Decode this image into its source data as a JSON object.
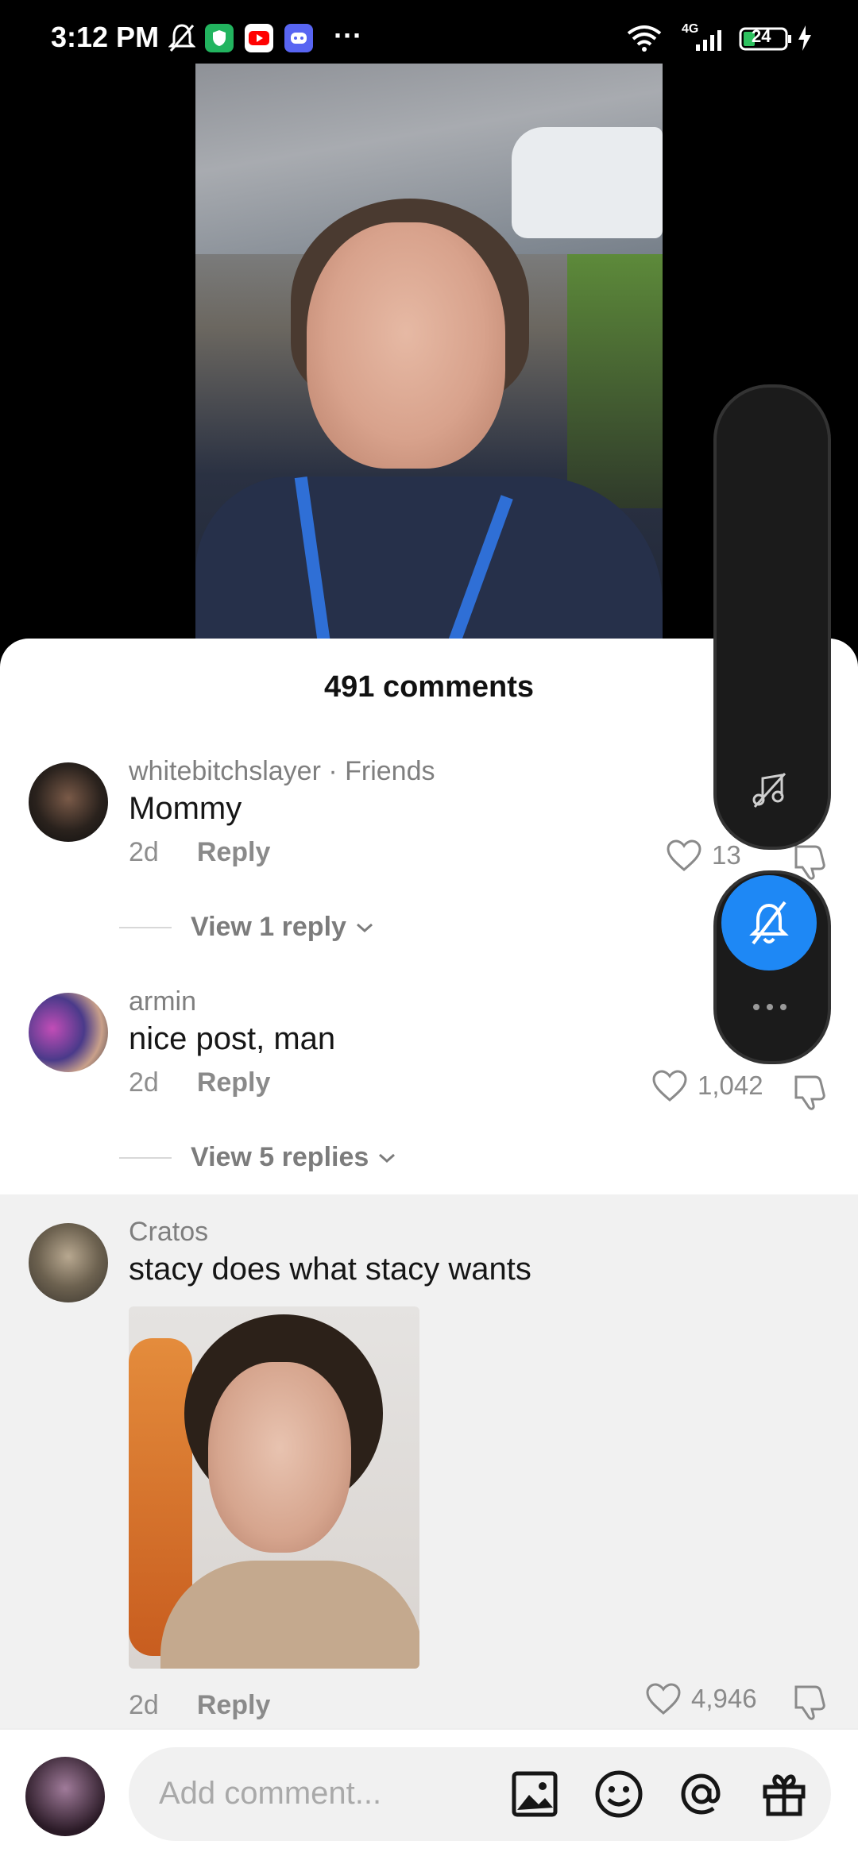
{
  "status_bar": {
    "time": "3:12 PM",
    "network": "4G",
    "battery": "24",
    "more": "···"
  },
  "sheet": {
    "title": "491 comments"
  },
  "comments": [
    {
      "username": "whitebitchslayer · Friends",
      "text": "Mommy",
      "time": "2d",
      "reply_label": "Reply",
      "likes": "13",
      "view_replies": "View 1 reply"
    },
    {
      "username": "armin",
      "text": "nice post, man",
      "time": "2d",
      "reply_label": "Reply",
      "likes": "1,042",
      "view_replies": "View 5 replies"
    },
    {
      "username": "Cratos",
      "text": "stacy does what stacy wants",
      "time": "2d",
      "reply_label": "Reply",
      "likes": "4,946"
    }
  ],
  "input": {
    "placeholder": "Add comment..."
  },
  "icons": {
    "float_top": "music-off-icon",
    "float_bell": "bell-off-icon",
    "float_more": "more-icon"
  },
  "colors": {
    "accent": "#1e88f5",
    "sheet": "#ffffff",
    "highlight": "#f1f1f1"
  }
}
